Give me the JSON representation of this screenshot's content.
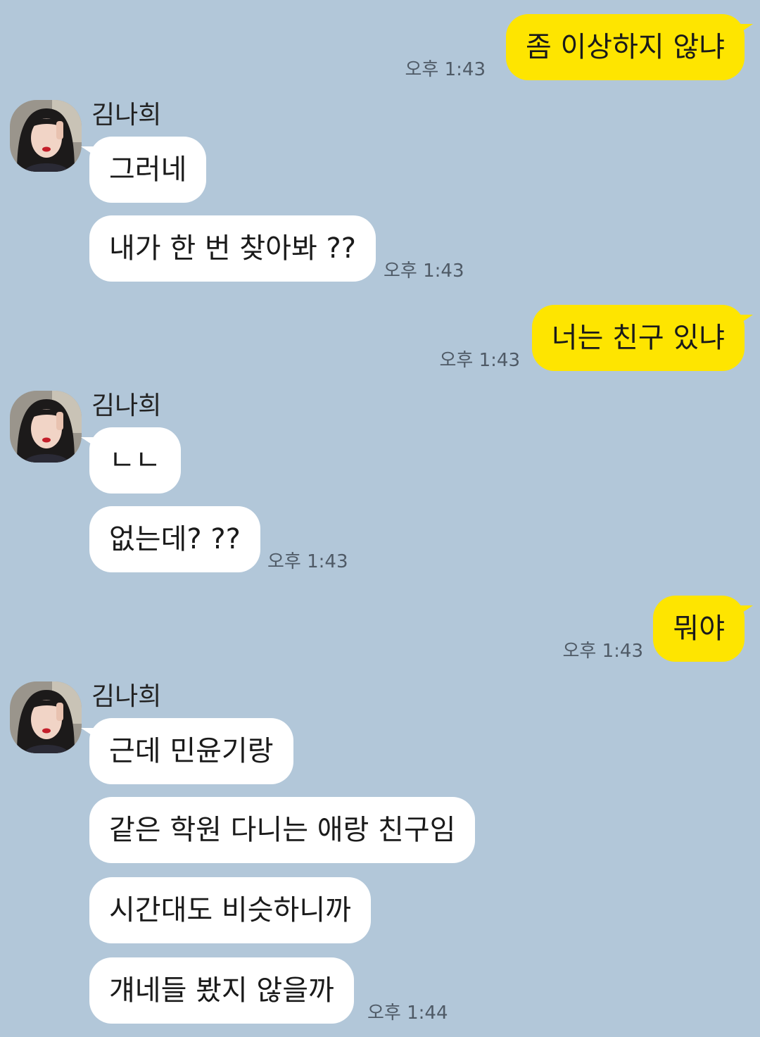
{
  "contact": {
    "name": "김나희"
  },
  "messages": [
    {
      "text": "좀 이상하지 않냐",
      "time": "오후 1:43"
    },
    {
      "text": "그러네"
    },
    {
      "text": "내가 한 번 찾아봐 ??",
      "time": "오후 1:43"
    },
    {
      "text": "너는 친구 있냐",
      "time": "오후 1:43"
    },
    {
      "text": "ㄴㄴ"
    },
    {
      "text": "없는데? ??",
      "time": "오후 1:43"
    },
    {
      "text": "뭐야",
      "time": "오후 1:43"
    },
    {
      "text": "근데 민윤기랑"
    },
    {
      "text": "같은 학원 다니는 애랑 친구임"
    },
    {
      "text": "시간대도 비슷하니까"
    },
    {
      "text": "걔네들 봤지 않을까",
      "time": "오후 1:44"
    }
  ],
  "colors": {
    "background": "#b2c7d9",
    "outgoing_bubble": "#fee500",
    "incoming_bubble": "#ffffff"
  }
}
